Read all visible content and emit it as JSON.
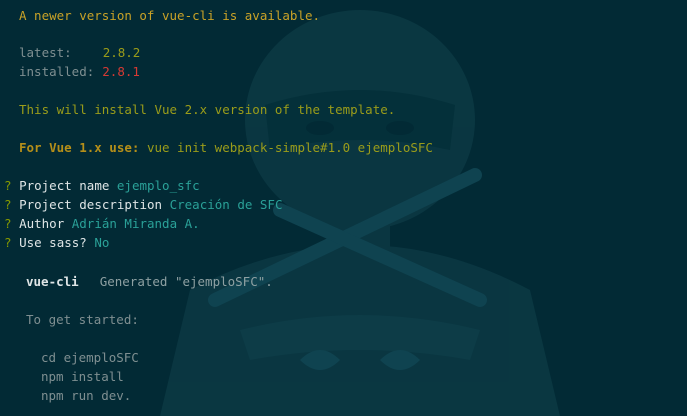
{
  "terminal": {
    "update_notice": "A newer version of vue-cli is available.",
    "versions": {
      "latest_label": "latest:",
      "latest_value": "2.8.2",
      "installed_label": "installed:",
      "installed_value": "2.8.1"
    },
    "install_note": "This will install Vue 2.x version of the template.",
    "vue1_hint": {
      "label": "For Vue 1.x use:",
      "command": "vue init webpack-simple#1.0 ejemploSFC"
    },
    "prompts": [
      {
        "marker": "?",
        "question": "Project name",
        "answer": "ejemplo_sfc"
      },
      {
        "marker": "?",
        "question": "Project description",
        "answer": "Creación de SFC"
      },
      {
        "marker": "?",
        "question": "Author",
        "answer": "Adrián Miranda A."
      },
      {
        "marker": "?",
        "question": "Use sass?",
        "answer": "No"
      }
    ],
    "generated": {
      "tool": "vue-cli",
      "message": "Generated \"ejemploSFC\"."
    },
    "get_started": "To get started:",
    "commands": [
      "cd ejemploSFC",
      "npm install",
      "npm run dev."
    ]
  },
  "colors": {
    "background": "#022a35",
    "yellow": "#b58f19",
    "olive": "#9a9c1a",
    "red": "#d63a34",
    "cyan": "#2aa198",
    "gray": "#7f8f91"
  }
}
